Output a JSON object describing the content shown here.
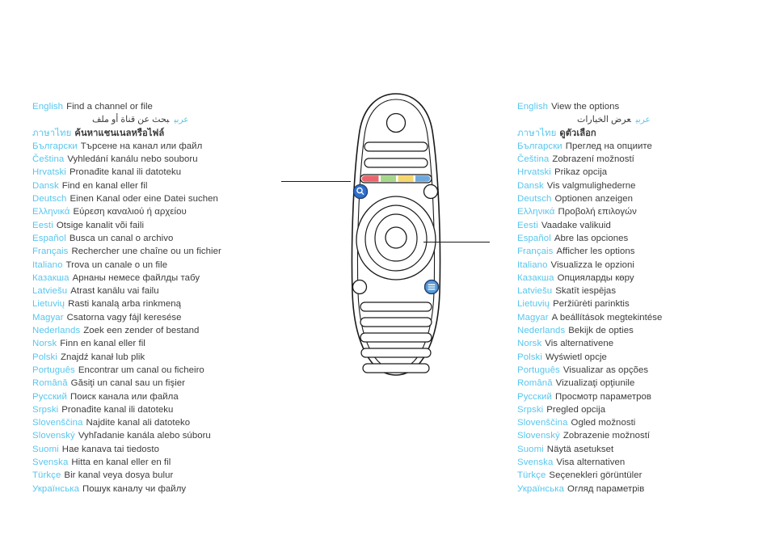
{
  "colors": {
    "language_label": "#57c6ee",
    "translation_text": "#3b3b3b",
    "remote_outline": "#1a1a1a",
    "button_blue": "#2f6fce",
    "button_blue_light": "#5b9bd5",
    "color_key_red": "#e8666e",
    "color_key_green": "#a5d68a",
    "color_key_yellow": "#f5d76e",
    "color_key_blue": "#6fa8dc",
    "page_background": "#ffffff"
  },
  "left_column": {
    "caption_key": "search",
    "rows": [
      {
        "lang": "English",
        "text": "Find a channel or file",
        "dir": "ltr"
      },
      {
        "lang": "عربي",
        "text": "بحث عن قناة أو ملف",
        "dir": "rtl"
      },
      {
        "lang": "ภาษาไทย",
        "text": "ค้นหาแชนเนลหรือไฟล์",
        "dir": "thai"
      },
      {
        "lang": "Български",
        "text": "Търсене на канал или файл",
        "dir": "ltr"
      },
      {
        "lang": "Čeština",
        "text": "Vyhledání kanálu nebo souboru",
        "dir": "ltr"
      },
      {
        "lang": "Hrvatski",
        "text": "Pronađite kanal ili datoteku",
        "dir": "ltr"
      },
      {
        "lang": "Dansk",
        "text": "Find en kanal eller fil",
        "dir": "ltr"
      },
      {
        "lang": "Deutsch",
        "text": "Einen Kanal oder eine Datei suchen",
        "dir": "ltr"
      },
      {
        "lang": "Ελληνικά",
        "text": "Εύρεση καναλιού ή αρχείου",
        "dir": "ltr"
      },
      {
        "lang": "Eesti",
        "text": "Otsige kanalit või faili",
        "dir": "ltr"
      },
      {
        "lang": "Español",
        "text": "Busca un canal o archivo",
        "dir": "ltr"
      },
      {
        "lang": "Français",
        "text": "Rechercher une chaîne ou un fichier",
        "dir": "ltr"
      },
      {
        "lang": "Italiano",
        "text": "Trova un canale o un file",
        "dir": "ltr"
      },
      {
        "lang": "Казакша",
        "text": "Арнаны немесе файлды табу",
        "dir": "ltr"
      },
      {
        "lang": "Latviešu",
        "text": "Atrast kanālu vai failu",
        "dir": "ltr"
      },
      {
        "lang": "Lietuvių",
        "text": "Rasti kanalą arba rinkmeną",
        "dir": "ltr"
      },
      {
        "lang": "Magyar",
        "text": "Csatorna vagy fájl keresése",
        "dir": "ltr"
      },
      {
        "lang": "Nederlands",
        "text": "Zoek een zender of bestand",
        "dir": "ltr"
      },
      {
        "lang": "Norsk",
        "text": "Finn en kanal eller fil",
        "dir": "ltr"
      },
      {
        "lang": "Polski",
        "text": "Znajdź kanał lub plik",
        "dir": "ltr"
      },
      {
        "lang": "Português",
        "text": "Encontrar um canal ou ficheiro",
        "dir": "ltr"
      },
      {
        "lang": "Română",
        "text": "Găsiţi un canal sau un fişier",
        "dir": "ltr"
      },
      {
        "lang": "Русский",
        "text": "Поиск канала или файла",
        "dir": "ltr"
      },
      {
        "lang": "Srpski",
        "text": "Pronađite kanal ili datoteku",
        "dir": "ltr"
      },
      {
        "lang": "Slovenščina",
        "text": "Najdite kanal ali datoteko",
        "dir": "ltr"
      },
      {
        "lang": "Slovenský",
        "text": "Vyhľadanie kanála alebo súboru",
        "dir": "ltr"
      },
      {
        "lang": "Suomi",
        "text": "Hae kanava tai tiedosto",
        "dir": "ltr"
      },
      {
        "lang": "Svenska",
        "text": "Hitta en kanal eller en fil",
        "dir": "ltr"
      },
      {
        "lang": "Türkçe",
        "text": "Bir kanal veya dosya bulur",
        "dir": "ltr"
      },
      {
        "lang": "Українська",
        "text": "Пошук каналу чи файлу",
        "dir": "ltr"
      }
    ]
  },
  "right_column": {
    "caption_key": "options",
    "rows": [
      {
        "lang": "English",
        "text": "View the options",
        "dir": "ltr"
      },
      {
        "lang": "عربي",
        "text": "عرض الخيارات",
        "dir": "rtl"
      },
      {
        "lang": "ภาษาไทย",
        "text": "ดูตัวเลือก",
        "dir": "thai"
      },
      {
        "lang": "Български",
        "text": "Преглед на опциите",
        "dir": "ltr"
      },
      {
        "lang": "Čeština",
        "text": "Zobrazení možností",
        "dir": "ltr"
      },
      {
        "lang": "Hrvatski",
        "text": "Prikaz opcija",
        "dir": "ltr"
      },
      {
        "lang": "Dansk",
        "text": "Vis valgmulighederne",
        "dir": "ltr"
      },
      {
        "lang": "Deutsch",
        "text": "Optionen anzeigen",
        "dir": "ltr"
      },
      {
        "lang": "Ελληνικά",
        "text": "Προβολή επιλογών",
        "dir": "ltr"
      },
      {
        "lang": "Eesti",
        "text": "Vaadake valikuid",
        "dir": "ltr"
      },
      {
        "lang": "Español",
        "text": "Abre las opciones",
        "dir": "ltr"
      },
      {
        "lang": "Français",
        "text": "Afficher les options",
        "dir": "ltr"
      },
      {
        "lang": "Italiano",
        "text": "Visualizza le opzioni",
        "dir": "ltr"
      },
      {
        "lang": "Казакша",
        "text": "Опцияларды көру",
        "dir": "ltr"
      },
      {
        "lang": "Latviešu",
        "text": "Skatīt iespējas",
        "dir": "ltr"
      },
      {
        "lang": "Lietuvių",
        "text": "Peržiūrėti parinktis",
        "dir": "ltr"
      },
      {
        "lang": "Magyar",
        "text": "A beállítások megtekintése",
        "dir": "ltr"
      },
      {
        "lang": "Nederlands",
        "text": "Bekijk de opties",
        "dir": "ltr"
      },
      {
        "lang": "Norsk",
        "text": "Vis alternativene",
        "dir": "ltr"
      },
      {
        "lang": "Polski",
        "text": "Wyświetl opcje",
        "dir": "ltr"
      },
      {
        "lang": "Português",
        "text": "Visualizar as opções",
        "dir": "ltr"
      },
      {
        "lang": "Română",
        "text": "Vizualizaţi opţiunile",
        "dir": "ltr"
      },
      {
        "lang": "Русский",
        "text": "Просмотр параметров",
        "dir": "ltr"
      },
      {
        "lang": "Srpski",
        "text": "Pregled opcija",
        "dir": "ltr"
      },
      {
        "lang": "Slovenščina",
        "text": "Ogled možnosti",
        "dir": "ltr"
      },
      {
        "lang": "Slovenský",
        "text": "Zobrazenie možností",
        "dir": "ltr"
      },
      {
        "lang": "Suomi",
        "text": "Näytä asetukset",
        "dir": "ltr"
      },
      {
        "lang": "Svenska",
        "text": "Visa alternativen",
        "dir": "ltr"
      },
      {
        "lang": "Türkçe",
        "text": "Seçenekleri görüntüler",
        "dir": "ltr"
      },
      {
        "lang": "Українська",
        "text": "Огляд параметрів",
        "dir": "ltr"
      }
    ]
  },
  "remote": {
    "search_button_icon": "magnifier-icon",
    "options_button_icon": "list-lines-icon",
    "color_keys": [
      "red",
      "green",
      "yellow",
      "blue"
    ]
  }
}
